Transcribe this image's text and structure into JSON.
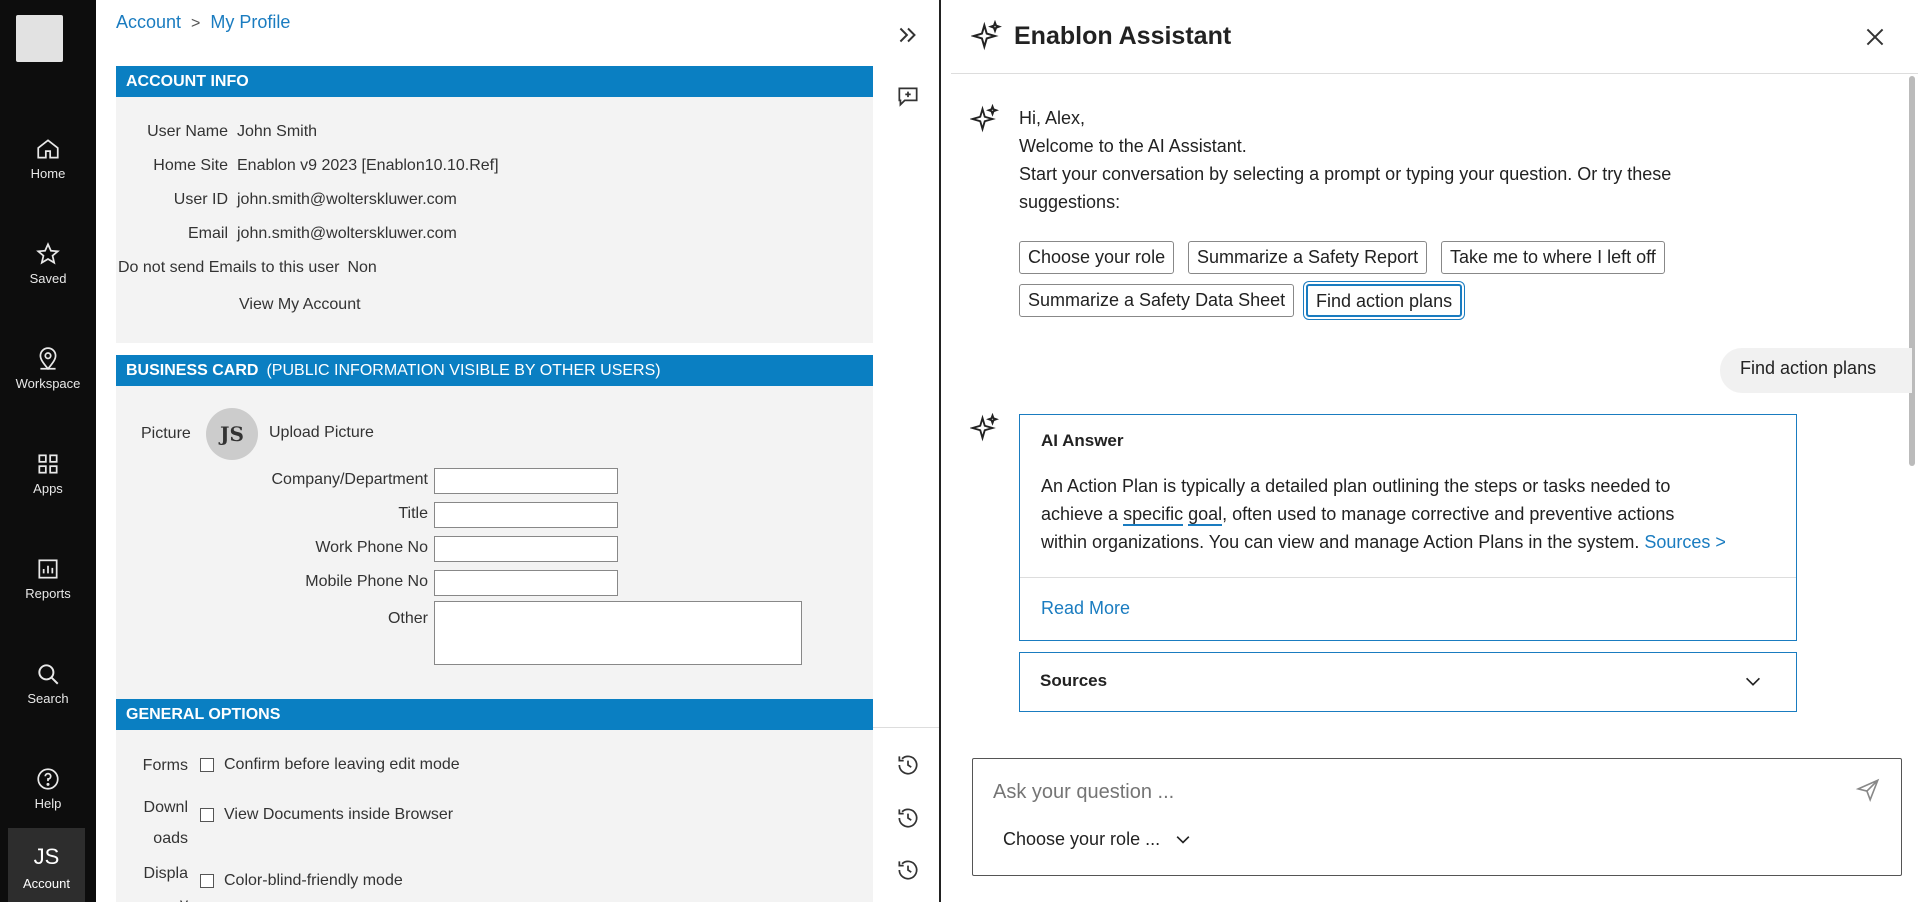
{
  "nav": {
    "items": [
      {
        "label": "Home",
        "icon": "home-icon"
      },
      {
        "label": "Saved",
        "icon": "star-icon"
      },
      {
        "label": "Workspace",
        "icon": "location-pin-icon"
      },
      {
        "label": "Apps",
        "icon": "apps-grid-icon"
      },
      {
        "label": "Reports",
        "icon": "reports-chart-icon"
      },
      {
        "label": "Search",
        "icon": "search-icon"
      },
      {
        "label": "Help",
        "icon": "help-icon"
      }
    ],
    "account": {
      "initials": "JS",
      "label": "Account"
    }
  },
  "breadcrumb": {
    "root": "Account",
    "sep": ">",
    "current": "My Profile"
  },
  "account_info": {
    "title": "ACCOUNT INFO",
    "user_name_label": "User Name",
    "user_name": "John Smith",
    "home_site_label": "Home Site",
    "home_site": "Enablon v9 2023 [Enablon10.10.Ref]",
    "user_id_label": "User ID",
    "user_id": "john.smith@wolterskluwer.com",
    "email_label": "Email",
    "email": "john.smith@wolterskluwer.com",
    "no_email_label": "Do not send Emails to this user",
    "no_email_value": "Non",
    "view_account": "View My Account"
  },
  "business_card": {
    "title": "BUSINESS CARD",
    "subtitle": "(PUBLIC INFORMATION VISIBLE BY OTHER USERS)",
    "picture_label": "Picture",
    "avatar_initials": "JS",
    "upload": "Upload Picture",
    "company_label": "Company/Department",
    "title_label": "Title",
    "work_phone_label": "Work Phone No",
    "mobile_phone_label": "Mobile Phone No",
    "other_label": "Other"
  },
  "general_options": {
    "title": "GENERAL OPTIONS",
    "forms_label": "Forms",
    "forms_option": "Confirm before leaving edit mode",
    "downloads_label_1": "Downl",
    "downloads_label_2": "oads",
    "downloads_option": "View Documents inside Browser",
    "display_label_1": "Displa",
    "display_label_2": "y",
    "display_option": "Color-blind-friendly mode"
  },
  "toolcol": {
    "collapse_icon": "double-chevron-right-icon",
    "new_chat_icon": "new-chat-icon",
    "history_icon": "history-icon"
  },
  "assistant": {
    "title": "Enablon Assistant",
    "greeting": "Hi, Alex,",
    "welcome": "Welcome to the AI Assistant.",
    "intro_1": "Start your conversation by selecting a prompt or typing your question. Or try these",
    "intro_2": "suggestions:",
    "chips": [
      "Choose your role",
      "Summarize a Safety Report",
      "Take me to where I left off",
      "Summarize a Safety Data Sheet",
      "Find action plans"
    ],
    "user_message": "Find action plans",
    "answer_title": "AI Answer",
    "answer_1_pre": "An Action Plan is typically a detailed plan outlining the steps or tasks needed to",
    "answer_2_pre": "achieve a ",
    "answer_2_u1": "specific",
    "answer_2_sp": " ",
    "answer_2_u2": "goal",
    "answer_2_post": ", often used to manage corrective and preventive actions",
    "answer_3": "within organizations. You can view and manage Action Plans in the system.",
    "answer_sources_link": "Sources >",
    "read_more": "Read More",
    "sources_title": "Sources",
    "input_placeholder": "Ask your question ...",
    "role_select": "Choose your role ...",
    "accent": "#1a7cc0"
  }
}
